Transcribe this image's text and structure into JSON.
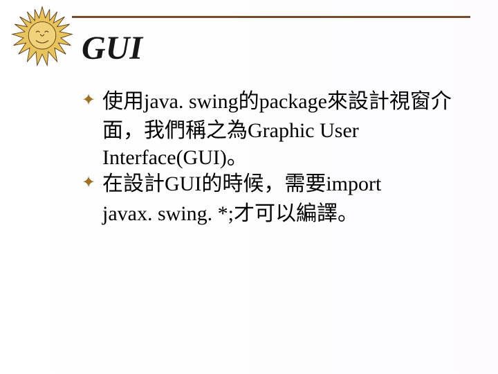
{
  "title": "GUI",
  "bullets": [
    {
      "line1": "使用java. swing的package來設計視窗介",
      "line2": "面，我們稱之為Graphic User",
      "line3": "Interface(GUI)。"
    },
    {
      "line1": "在設計GUI的時候，需要import",
      "line2": "javax. swing. *;才可以編譯。"
    }
  ]
}
